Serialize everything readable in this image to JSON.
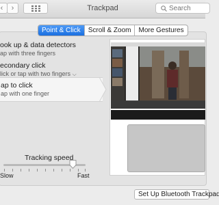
{
  "window": {
    "title": "Trackpad",
    "back_glyph": "‹",
    "forward_glyph": "›",
    "grid_icon": "show-all-grid-icon",
    "search": {
      "placeholder": "Search",
      "icon": "search-icon"
    }
  },
  "tabs": [
    {
      "label": "Point & Click",
      "active": true
    },
    {
      "label": "Scroll & Zoom",
      "active": false
    },
    {
      "label": "More Gestures",
      "active": false
    }
  ],
  "options": [
    {
      "title": "ook up & data detectors",
      "subtitle": "ap with three fingers"
    },
    {
      "title": "econdary click",
      "subtitle": "lick or tap with two fingers",
      "has_dropdown": true
    },
    {
      "title": "ap to click",
      "subtitle": "ap with one finger",
      "selected": true
    }
  ],
  "tracking": {
    "label": "Tracking speed",
    "min_label": "Slow",
    "max_label": "Fast",
    "value_fraction": 0.83
  },
  "bluetooth_button": {
    "label": "Set Up Bluetooth Trackpad"
  },
  "colors": {
    "accent": "#1a6fe0",
    "window_bg": "#ececec",
    "panel_bg": "#e3e3e3"
  }
}
